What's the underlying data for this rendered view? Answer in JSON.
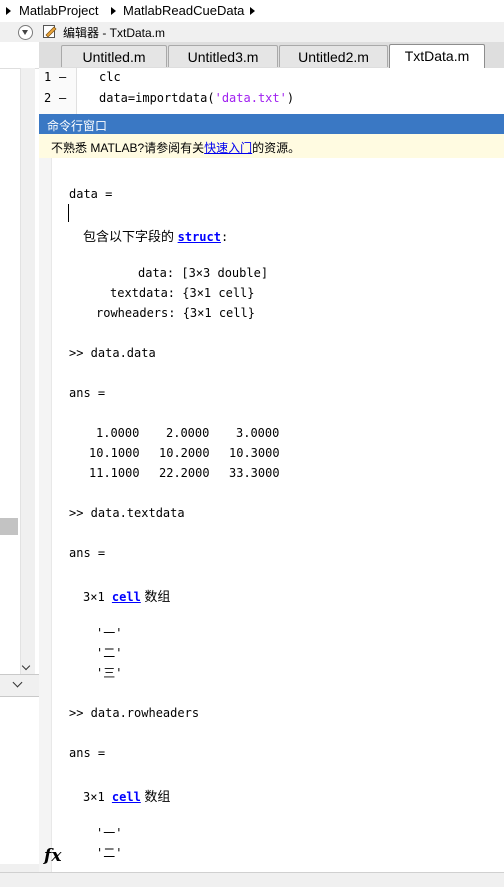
{
  "breadcrumb": [
    "MatlabProject",
    "MatlabReadCueData"
  ],
  "editor": {
    "title": "编辑器 - TxtData.m",
    "tabs": [
      {
        "label": "Untitled.m"
      },
      {
        "label": "Untitled3.m"
      },
      {
        "label": "Untitled2.m"
      },
      {
        "label": "TxtData.m"
      }
    ],
    "lines": [
      {
        "num": "1",
        "marker": "–",
        "code": "clc"
      },
      {
        "num": "2",
        "marker": "–",
        "code_prefix": "data=importdata(",
        "code_string": "'data.txt'",
        "code_suffix": ")"
      }
    ]
  },
  "command_window": {
    "title": "命令行窗口",
    "banner": {
      "prefix": "不熟悉 MATLAB?请参阅有关",
      "link": "快速入门",
      "suffix": "的资源。"
    },
    "out": {
      "data_eq": "data =",
      "struct_pre": "包含以下字段的 ",
      "struct_kw": "struct",
      "struct_colon": ":",
      "f1": "data: [3×3 double]",
      "f2": "textdata: {3×1 cell}",
      "f3": "rowheaders: {3×1 cell}",
      "cmd1": ">> data.data",
      "ans1": "ans =",
      "r1": [
        "1.0000",
        "2.0000",
        "3.0000"
      ],
      "r2": [
        "10.1000",
        "10.2000",
        "10.3000"
      ],
      "r3": [
        "11.1000",
        "22.2000",
        "33.3000"
      ],
      "cmd2": ">> data.textdata",
      "ans2": "ans =",
      "cell_size1": "3×1 ",
      "cell_kw1": "cell",
      "cell_suffix1": " 数组",
      "t1": "'一'",
      "t2": "'二'",
      "t3": "'三'",
      "cmd3": ">> data.rowheaders",
      "ans3": "ans =",
      "cell_size2": "3×1 ",
      "cell_kw2": "cell",
      "cell_suffix2": " 数组",
      "h1": "'一'",
      "h2": "'二'"
    },
    "prompt_icon": "fx"
  }
}
